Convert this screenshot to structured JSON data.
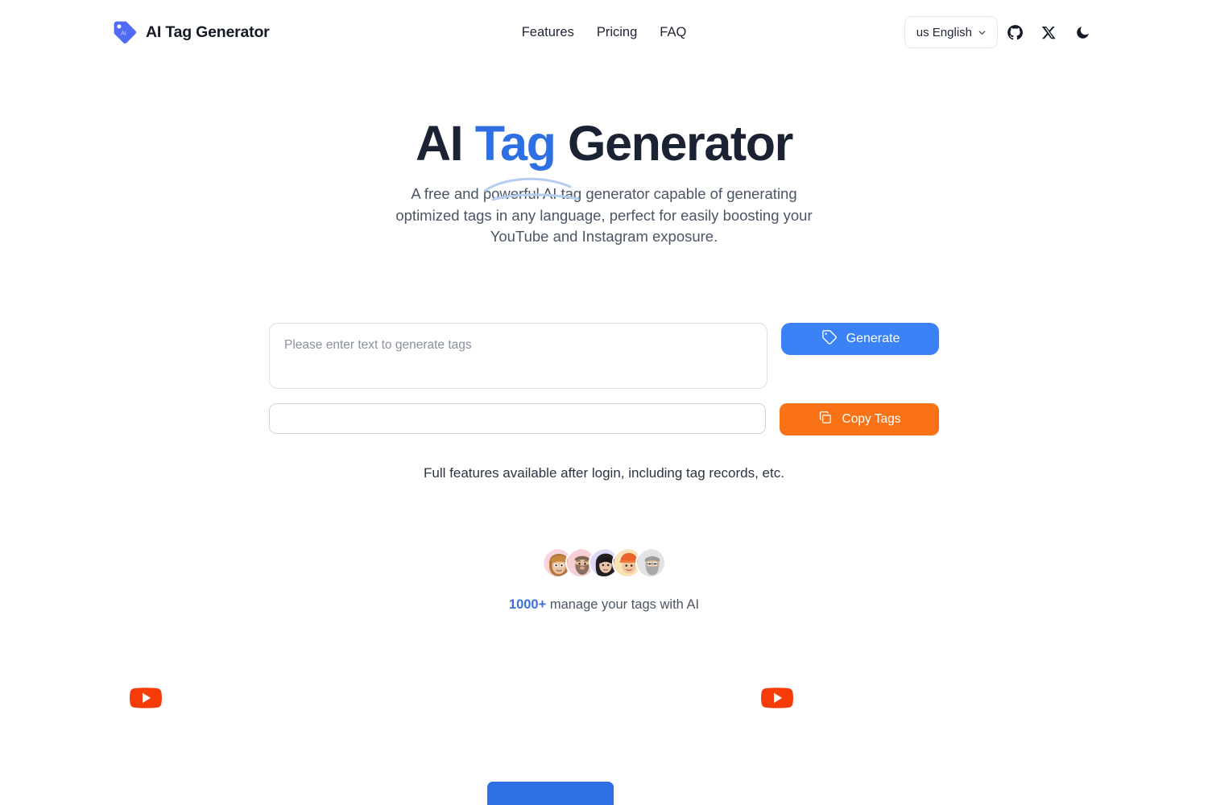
{
  "header": {
    "brand": {
      "name": "AI Tag Generator",
      "mark_label": "AI",
      "mark_color": "#4f6af5"
    },
    "nav": [
      {
        "label": "Features"
      },
      {
        "label": "Pricing"
      },
      {
        "label": "FAQ"
      }
    ],
    "language": {
      "flag": "us",
      "label": "English",
      "full_label": "us English"
    },
    "actions": [
      {
        "name": "github-icon",
        "title": "GitHub"
      },
      {
        "name": "x-twitter-icon",
        "title": "X"
      },
      {
        "name": "dark-mode-icon",
        "title": "Dark mode"
      }
    ]
  },
  "hero": {
    "title_part1": "AI ",
    "title_accent": "Tag",
    "title_part2": " Generator",
    "accent_color": "#2f6fe4",
    "subtitle": "A free and powerful AI tag generator capable of generating optimized tags in any language, perfect for easily boosting your YouTube and Instagram exposure."
  },
  "form": {
    "textarea_placeholder": "Please enter text to generate tags",
    "textarea_value": "",
    "generate_label": "Generate",
    "generate_color": "#3b82f6",
    "result_placeholder": "",
    "result_value": "",
    "copy_label": "Copy Tags",
    "copy_color": "#f97316",
    "login_note": "Full features available after login, including tag records, etc."
  },
  "social": {
    "avatar_count": 5,
    "avatars": [
      {
        "bg": "#f7d5df",
        "skin": "#e8c3a4",
        "hair": "#b8793f",
        "name": "avatar-1"
      },
      {
        "bg": "#f6cfd6",
        "skin": "#e6c0a0",
        "hair": "#8a7060",
        "name": "avatar-2"
      },
      {
        "bg": "#ded9f7",
        "skin": "#e9c7ab",
        "hair": "#241f24",
        "name": "avatar-3"
      },
      {
        "bg": "#fae2b6",
        "skin": "#ecc7a3",
        "hair": "#e8622a",
        "name": "avatar-4"
      },
      {
        "bg": "#e2e2e4",
        "skin": "#d9b89a",
        "hair": "#9a9a9c",
        "name": "avatar-5"
      }
    ],
    "count_label": "1000+",
    "count_color": "#3b6fe0",
    "tagline": "manage your tags with AI"
  },
  "lower": {
    "youtube_icons": [
      {
        "name": "youtube-icon-left",
        "color": "#f73c09"
      },
      {
        "name": "youtube-icon-right",
        "color": "#f73c09"
      }
    ],
    "bottom_button_color": "#2f6fe4"
  }
}
